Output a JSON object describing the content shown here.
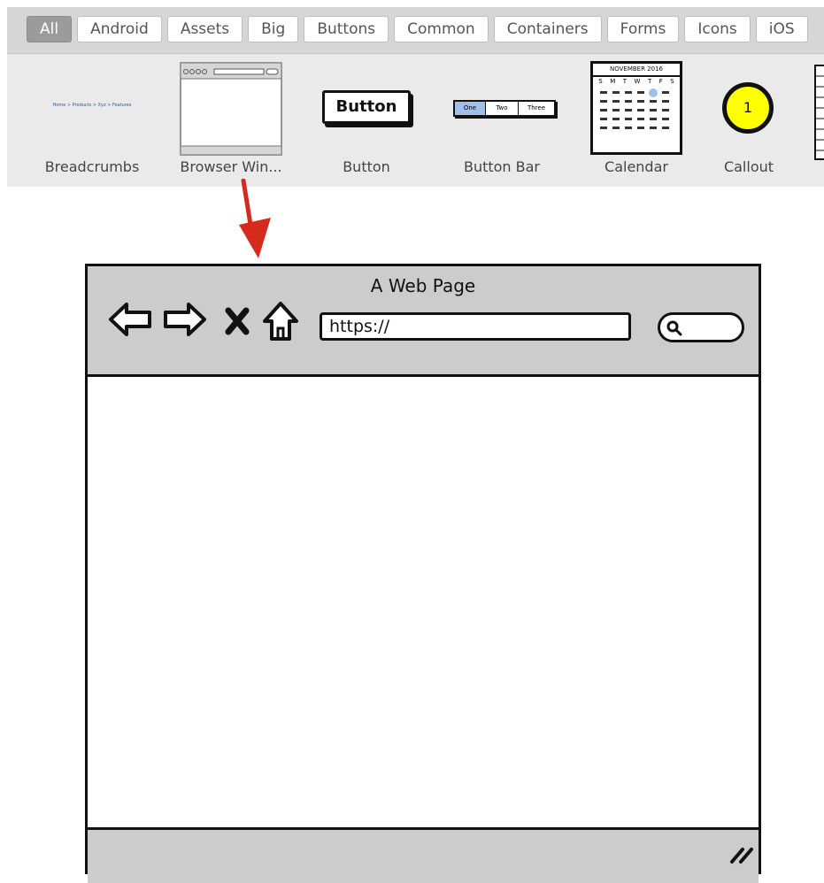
{
  "tabs": [
    "All",
    "Android",
    "Assets",
    "Big",
    "Buttons",
    "Common",
    "Containers",
    "Forms",
    "Icons",
    "iOS"
  ],
  "active_tab": "All",
  "shelf": {
    "items": [
      {
        "label": "Breadcrumbs",
        "preview_text": "Home > Products > Xyz > Features"
      },
      {
        "label": "Browser Win..."
      },
      {
        "label": "Button",
        "preview_text": "Button"
      },
      {
        "label": "Button Bar",
        "buttons": [
          "One",
          "Two",
          "Three"
        ]
      },
      {
        "label": "Calendar",
        "month": "NOVEMBER 2016",
        "weekdays": [
          "S",
          "M",
          "T",
          "W",
          "T",
          "F",
          "S"
        ]
      },
      {
        "label": "Callout",
        "preview_text": "1"
      }
    ]
  },
  "mockup": {
    "title": "A Web Page",
    "url": "https://"
  },
  "colors": {
    "arrow": "#d52b1e",
    "callout": "#ffff00",
    "button_bar_selected": "#9fc0e8"
  },
  "icons": [
    "back-arrow-icon",
    "forward-arrow-icon",
    "stop-icon",
    "home-icon",
    "search-icon",
    "resize-grip-icon"
  ]
}
